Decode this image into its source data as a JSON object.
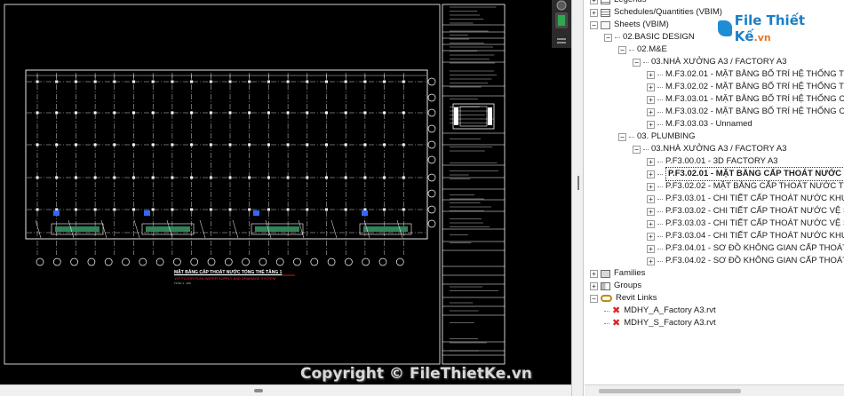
{
  "drawing": {
    "title": "MẶT BẰNG CẤP THOÁT NƯỚC TỔNG THỂ TẦNG 1",
    "subtitle": "1ST FLOOR PLAN WATER SUPPLY AND DRAINAGE SYSTEM",
    "scale": "TL/SC 1 : 100",
    "titleblock_labels": [
      "DỰ ÁN - PROJECT",
      "CHỦ ĐẦU TƯ - INVESTOR",
      "TỔNG GIÁM ĐỐC - GENERAL DIRECTOR",
      "TƯ VẤN THIẾT KẾ - DESIGN CONSULTANT",
      "GIÁM ĐỐC - DIRECTOR",
      "CHỦ NHIỆM THIẾT KẾ - DESIGN DIRECTOR",
      "CHỦ TRÌ THIẾT KẾ - PROJECT MANAGER",
      "THIẾT KẾ - DESIGNER",
      "KIỂM - CHECKED BY"
    ]
  },
  "browser": {
    "items": [
      {
        "level": 0,
        "expander": "+",
        "icon": "sched",
        "label": "Legends"
      },
      {
        "level": 0,
        "expander": "+",
        "icon": "sched",
        "label": "Schedules/Quantities (VBIM)"
      },
      {
        "level": 0,
        "expander": "-",
        "icon": "sheet",
        "label": "Sheets (VBIM)"
      },
      {
        "level": 1,
        "expander": "-",
        "icon": "",
        "label": "02.BASIC DESIGN"
      },
      {
        "level": 2,
        "expander": "-",
        "icon": "",
        "label": "02.M&E"
      },
      {
        "level": 3,
        "expander": "-",
        "icon": "",
        "label": "03.NHÀ XƯỞNG A3 / FACTORY A3"
      },
      {
        "level": 4,
        "expander": "+",
        "icon": "",
        "label": "M.F3.02.01 - MẶT BẰNG BỐ TRÍ HỆ THỐNG THÔ"
      },
      {
        "level": 4,
        "expander": "+",
        "icon": "",
        "label": "M.F3.02.02 - MẶT BẰNG BỐ TRÍ HỆ THỐNG THÔ"
      },
      {
        "level": 4,
        "expander": "+",
        "icon": "",
        "label": "M.F3.03.01 - MẶT BẰNG BỐ TRÍ HỆ THỐNG CHIẾ"
      },
      {
        "level": 4,
        "expander": "+",
        "icon": "",
        "label": "M.F3.03.02 - MẶT BẰNG BỐ TRÍ HỆ THỐNG CHIẾ"
      },
      {
        "level": 4,
        "expander": "+",
        "icon": "",
        "label": "M.F3.03.03 - Unnamed"
      },
      {
        "level": 2,
        "expander": "-",
        "icon": "",
        "label": "03. PLUMBING"
      },
      {
        "level": 3,
        "expander": "-",
        "icon": "",
        "label": "03.NHÀ XƯỞNG A3 / FACTORY A3"
      },
      {
        "level": 4,
        "expander": "+",
        "icon": "",
        "label": "P.F3.00.01 - 3D FACTORY A3"
      },
      {
        "level": 4,
        "expander": "+",
        "icon": "",
        "label": "P.F3.02.01 - MẶT BẰNG CẤP THOÁT NƯỚC T",
        "selected": true
      },
      {
        "level": 4,
        "expander": "+",
        "icon": "",
        "label": "P.F3.02.02 - MẶT BẰNG CẤP THOÁT NƯỚC TỔNG"
      },
      {
        "level": 4,
        "expander": "+",
        "icon": "",
        "label": "P.F3.03.01 - CHI TIẾT CẤP THOÁT NƯỚC KHU VỆ"
      },
      {
        "level": 4,
        "expander": "+",
        "icon": "",
        "label": "P.F3.03.02 - CHI TIẾT CẤP THOÁT NƯỚC VỆ SINH"
      },
      {
        "level": 4,
        "expander": "+",
        "icon": "",
        "label": "P.F3.03.03 - CHI TIẾT CẤP THOÁT NƯỚC VỆ SINH"
      },
      {
        "level": 4,
        "expander": "+",
        "icon": "",
        "label": "P.F3.03.04 - CHI TIẾT CẤP THOÁT NƯỚC KHU VỆ"
      },
      {
        "level": 4,
        "expander": "+",
        "icon": "",
        "label": "P.F3.04.01 - SƠ ĐỒ KHÔNG GIAN CẤP THOÁT NƯ"
      },
      {
        "level": 4,
        "expander": "+",
        "icon": "",
        "label": "P.F3.04.02 - SƠ ĐỒ KHÔNG GIAN CẤP THOÁT NƯ"
      },
      {
        "level": 0,
        "expander": "+",
        "icon": "fam",
        "label": "Families"
      },
      {
        "level": 0,
        "expander": "+",
        "icon": "grp",
        "label": "Groups"
      },
      {
        "level": 0,
        "expander": "-",
        "icon": "link",
        "label": "Revit Links"
      },
      {
        "level": 1,
        "expander": "",
        "icon": "broken",
        "label": "MDHY_A_Factory A3.rvt"
      },
      {
        "level": 1,
        "expander": "",
        "icon": "broken",
        "label": "MDHY_S_Factory A3.rvt"
      }
    ]
  },
  "watermark": {
    "logo_main": "File Thiết Kế",
    "logo_suffix": ".vn",
    "copyright": "Copyright © FileThietKe.vn"
  },
  "colors": {
    "canvas": "#000000",
    "line": "#ffffff",
    "grid_dash": "#cfcfcf",
    "title_red": "#ff2a2a",
    "pipe_green": "#3a9a6a",
    "marker_blue": "#3366ff",
    "broken_link": "#dd2222"
  }
}
